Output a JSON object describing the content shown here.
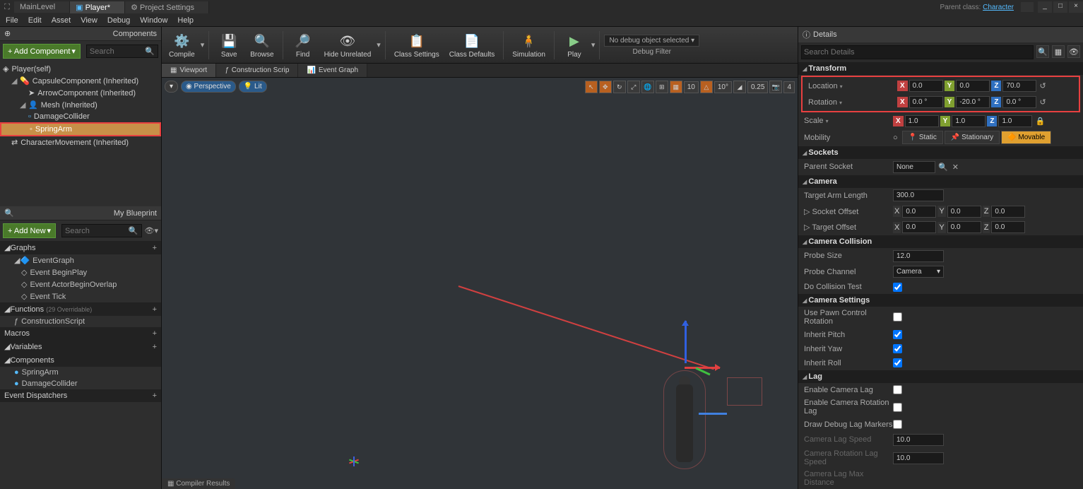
{
  "titlebar": {
    "tabs": [
      "MainLevel",
      "Player*",
      "Project Settings"
    ],
    "parent_label": "Parent class:",
    "parent_class": "Character"
  },
  "menu": {
    "items": [
      "File",
      "Edit",
      "Asset",
      "View",
      "Debug",
      "Window",
      "Help"
    ]
  },
  "components": {
    "header": "Components",
    "add_btn": "+ Add Component",
    "search_ph": "Search",
    "root": "Player(self)",
    "items": [
      {
        "name": "CapsuleComponent (Inherited)",
        "indent": 1
      },
      {
        "name": "ArrowComponent (Inherited)",
        "indent": 2
      },
      {
        "name": "Mesh (Inherited)",
        "indent": 2
      },
      {
        "name": "DamageCollider",
        "indent": 3
      },
      {
        "name": "SpringArm",
        "indent": 3,
        "selected": true
      },
      {
        "name": "CharacterMovement (Inherited)",
        "indent": 1
      }
    ]
  },
  "blueprint": {
    "header": "My Blueprint",
    "add_btn": "+ Add New",
    "search_ph": "Search",
    "graphs": {
      "title": "Graphs",
      "items": [
        "EventGraph",
        "Event BeginPlay",
        "Event ActorBeginOverlap",
        "Event Tick"
      ]
    },
    "functions": {
      "title": "Functions",
      "subtitle": "(29 Overridable)",
      "items": [
        "ConstructionScript"
      ]
    },
    "macros": {
      "title": "Macros"
    },
    "variables": {
      "title": "Variables"
    },
    "comps": {
      "title": "Components",
      "items": [
        "SpringArm",
        "DamageCollider"
      ]
    },
    "dispatchers": {
      "title": "Event Dispatchers"
    }
  },
  "toolbar": {
    "compile": "Compile",
    "save": "Save",
    "browse": "Browse",
    "find": "Find",
    "hide": "Hide Unrelated",
    "class_set": "Class Settings",
    "class_def": "Class Defaults",
    "sim": "Simulation",
    "play": "Play",
    "debug_sel": "No debug object selected",
    "debug_filter": "Debug Filter"
  },
  "viewport": {
    "tabs": [
      "Viewport",
      "Construction Scrip",
      "Event Graph"
    ],
    "perspective": "Perspective",
    "lit": "Lit",
    "snap1": "10",
    "snap2": "10°",
    "snap3": "0.25",
    "camspeed": "4",
    "compiler": "Compiler Results"
  },
  "details": {
    "header": "Details",
    "search_ph": "Search Details",
    "transform": {
      "title": "Transform",
      "location": {
        "label": "Location",
        "x": "0.0",
        "y": "0.0",
        "z": "70.0"
      },
      "rotation": {
        "label": "Rotation",
        "x": "0.0 °",
        "y": "-20.0 °",
        "z": "0.0 °"
      },
      "scale": {
        "label": "Scale",
        "x": "1.0",
        "y": "1.0",
        "z": "1.0"
      },
      "mobility": {
        "label": "Mobility",
        "static": "Static",
        "stationary": "Stationary",
        "movable": "Movable"
      }
    },
    "sockets": {
      "title": "Sockets",
      "parent": {
        "label": "Parent Socket",
        "value": "None"
      }
    },
    "camera": {
      "title": "Camera",
      "arm_length": {
        "label": "Target Arm Length",
        "value": "300.0"
      },
      "socket_offset": {
        "label": "Socket Offset",
        "x": "0.0",
        "y": "0.0",
        "z": "0.0"
      },
      "target_offset": {
        "label": "Target Offset",
        "x": "0.0",
        "y": "0.0",
        "z": "0.0"
      }
    },
    "collision": {
      "title": "Camera Collision",
      "probe_size": {
        "label": "Probe Size",
        "value": "12.0"
      },
      "probe_channel": {
        "label": "Probe Channel",
        "value": "Camera"
      },
      "do_test": {
        "label": "Do Collision Test"
      }
    },
    "cam_settings": {
      "title": "Camera Settings",
      "use_pawn": "Use Pawn Control Rotation",
      "pitch": "Inherit Pitch",
      "yaw": "Inherit Yaw",
      "roll": "Inherit Roll"
    },
    "lag": {
      "title": "Lag",
      "enable": "Enable Camera Lag",
      "enable_rot": "Enable Camera Rotation Lag",
      "draw": "Draw Debug Lag Markers",
      "speed": {
        "label": "Camera Lag Speed",
        "value": "10.0"
      },
      "rot_speed": {
        "label": "Camera Rotation Lag Speed",
        "value": "10.0"
      },
      "max_dist": "Camera Lag Max Distance"
    }
  }
}
